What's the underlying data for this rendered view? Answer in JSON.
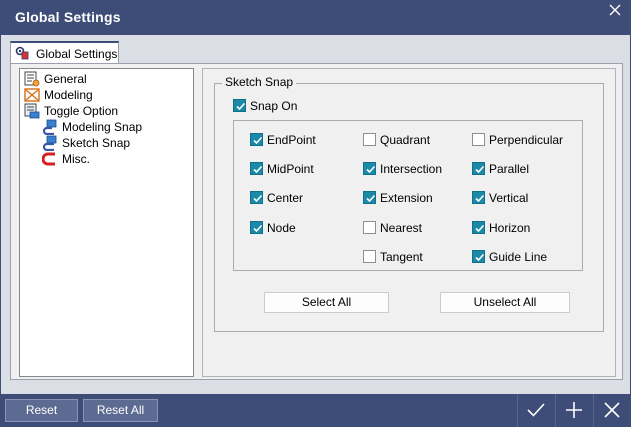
{
  "window": {
    "title": "Global Settings"
  },
  "tab": {
    "label": "Global Settings"
  },
  "tree": {
    "items": [
      {
        "label": "General"
      },
      {
        "label": "Modeling"
      },
      {
        "label": "Toggle Option"
      },
      {
        "label": "Modeling Snap"
      },
      {
        "label": "Sketch Snap"
      },
      {
        "label": "Misc."
      }
    ]
  },
  "sketch_snap": {
    "group_label": "Sketch Snap",
    "snap_on": {
      "label": "Snap On",
      "checked": true
    },
    "options": [
      {
        "label": "EndPoint",
        "checked": true
      },
      {
        "label": "Quadrant",
        "checked": false
      },
      {
        "label": "Perpendicular",
        "checked": false
      },
      {
        "label": "MidPoint",
        "checked": true
      },
      {
        "label": "Intersection",
        "checked": true
      },
      {
        "label": "Parallel",
        "checked": true
      },
      {
        "label": "Center",
        "checked": true
      },
      {
        "label": "Extension",
        "checked": true
      },
      {
        "label": "Vertical",
        "checked": true
      },
      {
        "label": "Node",
        "checked": true
      },
      {
        "label": "Nearest",
        "checked": false
      },
      {
        "label": "Horizon",
        "checked": true
      },
      {
        "label": "Tangent",
        "checked": false
      },
      {
        "label": "Guide Line",
        "checked": true
      }
    ],
    "select_all_label": "Select All",
    "unselect_all_label": "Unselect All"
  },
  "footer": {
    "reset_label": "Reset",
    "reset_all_label": "Reset All",
    "icons": [
      "check-icon",
      "plus-icon",
      "close-icon"
    ]
  },
  "colors": {
    "titlebar": "#3d4d78",
    "checkbox_checked": "#1b8aa8"
  }
}
